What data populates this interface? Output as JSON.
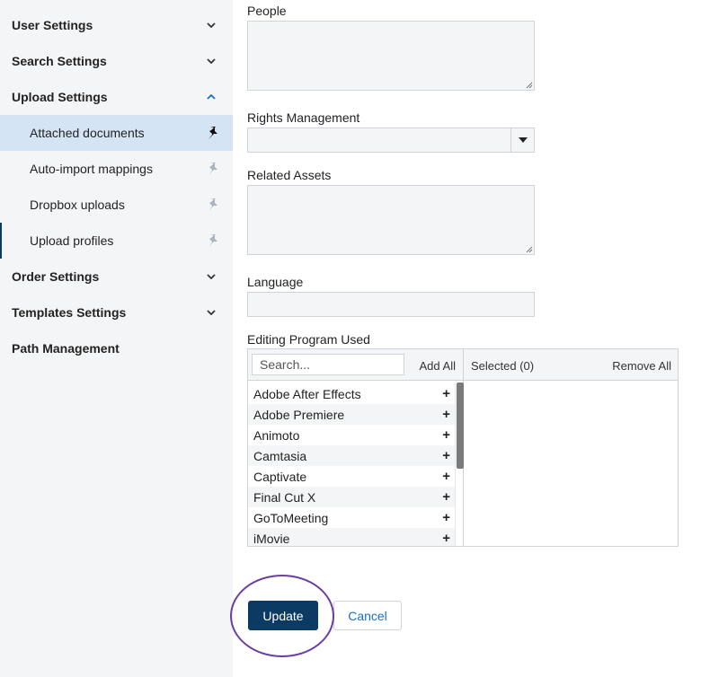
{
  "sidebar": {
    "sections": [
      {
        "label": "User Settings",
        "expanded": false
      },
      {
        "label": "Search Settings",
        "expanded": false
      },
      {
        "label": "Upload Settings",
        "expanded": true
      },
      {
        "label": "Order Settings",
        "expanded": false
      },
      {
        "label": "Templates Settings",
        "expanded": false
      },
      {
        "label": "Path Management"
      }
    ],
    "upload_items": [
      {
        "label": "Attached documents",
        "active": true,
        "pinned": true
      },
      {
        "label": "Auto-import mappings"
      },
      {
        "label": "Dropbox uploads"
      },
      {
        "label": "Upload profiles"
      }
    ]
  },
  "form": {
    "people_label": "People",
    "rights_label": "Rights Management",
    "related_label": "Related Assets",
    "language_label": "Language",
    "editing_label": "Editing Program Used"
  },
  "dual_list": {
    "search_placeholder": "Search...",
    "add_all": "Add All",
    "selected": "Selected (0)",
    "remove_all": "Remove All",
    "available": [
      "Adobe After Effects",
      "Adobe Premiere",
      "Animoto",
      "Camtasia",
      "Captivate",
      "Final Cut X",
      "GoToMeeting",
      "iMovie"
    ],
    "scroll_fraction": 0.0
  },
  "buttons": {
    "update": "Update",
    "cancel": "Cancel"
  },
  "colors": {
    "primary": "#0b3a63",
    "link": "#1a6fc0",
    "highlight": "#d4e4f4",
    "annotation": "#6a3ea1"
  }
}
